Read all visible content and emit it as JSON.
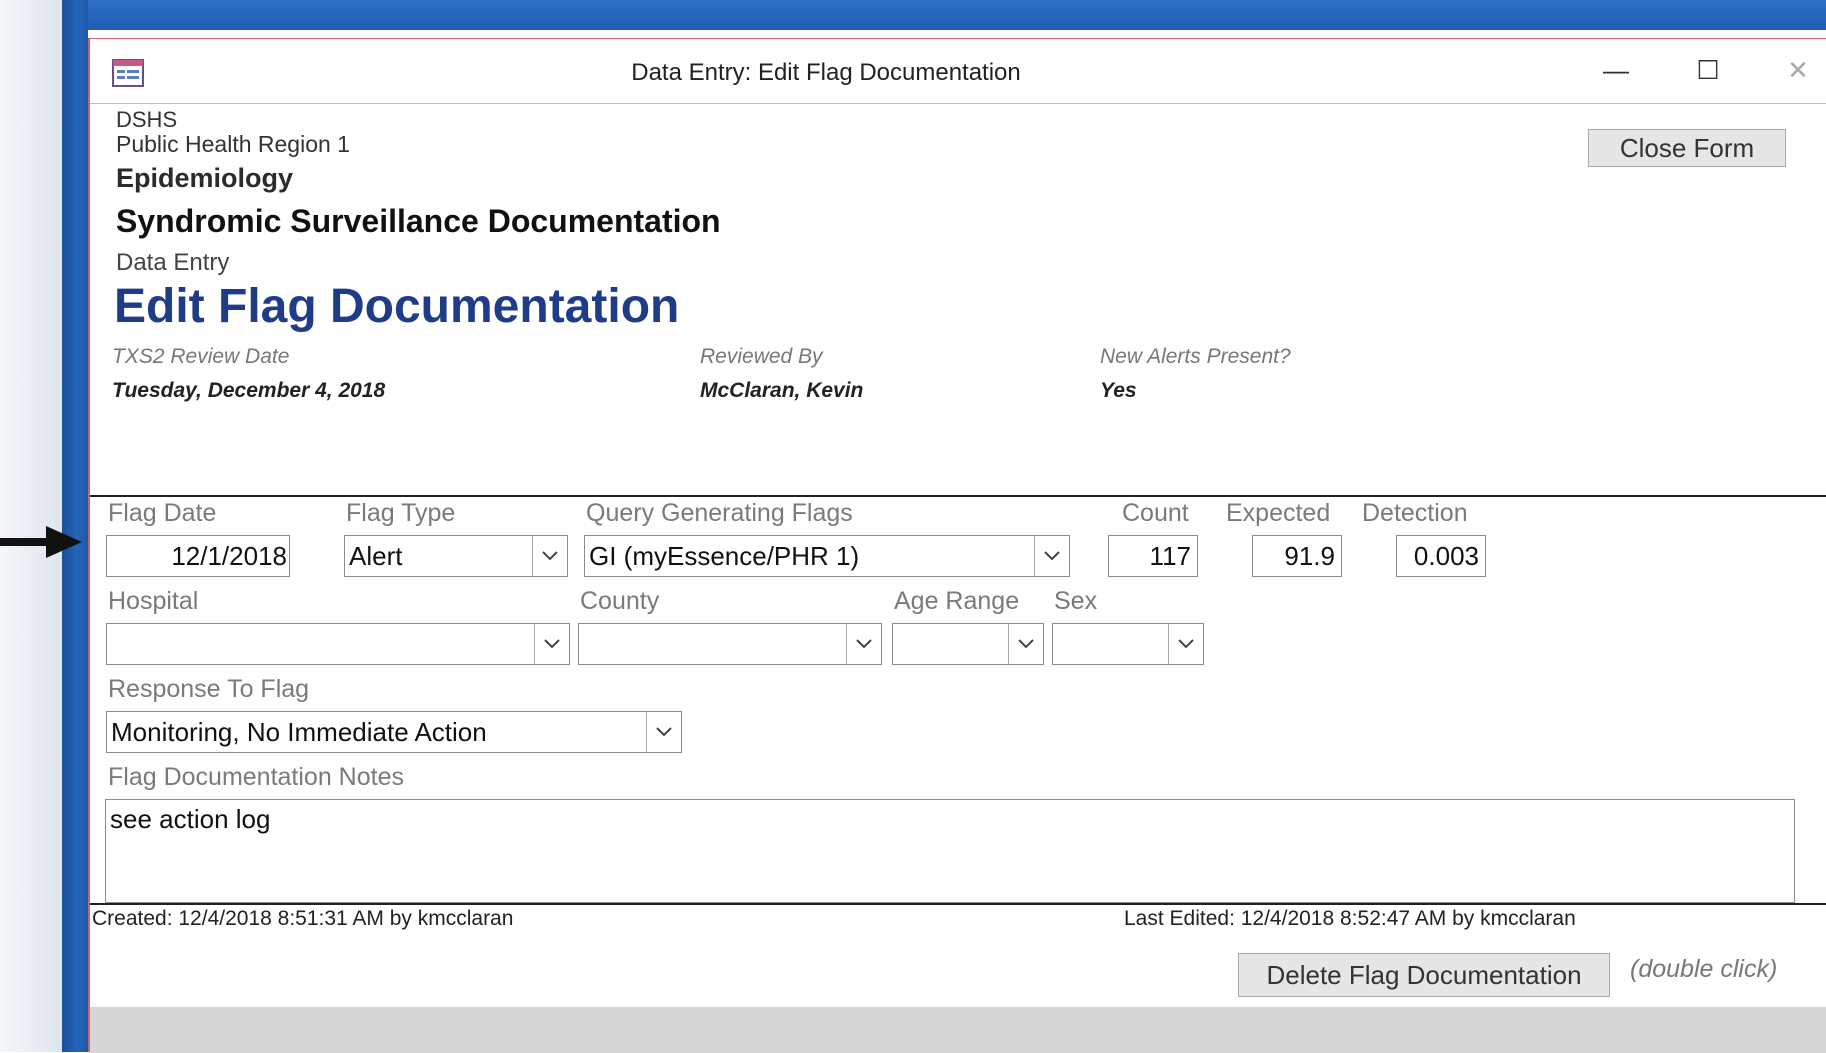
{
  "window": {
    "title": "Data Entry: Edit Flag Documentation"
  },
  "header": {
    "org": "DSHS",
    "region": "Public Health Region 1",
    "dept": "Epidemiology",
    "system": "Syndromic Surveillance Documentation",
    "section": "Data Entry",
    "page_title": "Edit Flag Documentation"
  },
  "close_form_label": "Close Form",
  "review": {
    "date_label": "TXS2 Review Date",
    "date_value": "Tuesday, December 4, 2018",
    "reviewer_label": "Reviewed By",
    "reviewer_value": "McClaran, Kevin",
    "alerts_label": "New Alerts Present?",
    "alerts_value": "Yes"
  },
  "fields": {
    "flag_date": {
      "label": "Flag Date",
      "value": "12/1/2018"
    },
    "flag_type": {
      "label": "Flag Type",
      "value": "Alert"
    },
    "query": {
      "label": "Query Generating Flags",
      "value": "GI (myEssence/PHR 1)"
    },
    "count": {
      "label": "Count",
      "value": "117"
    },
    "expected": {
      "label": "Expected",
      "value": "91.9"
    },
    "detection": {
      "label": "Detection",
      "value": "0.003"
    },
    "hospital": {
      "label": "Hospital",
      "value": ""
    },
    "county": {
      "label": "County",
      "value": ""
    },
    "age_range": {
      "label": "Age Range",
      "value": ""
    },
    "sex": {
      "label": "Sex",
      "value": ""
    },
    "response": {
      "label": "Response To Flag",
      "value": "Monitoring, No Immediate Action"
    },
    "notes": {
      "label": "Flag Documentation Notes",
      "value": "see action log"
    }
  },
  "footer": {
    "created": "Created: 12/4/2018 8:51:31 AM by kmcclaran",
    "last_edited": "Last Edited: 12/4/2018 8:52:47 AM by kmcclaran",
    "delete_label": "Delete Flag Documentation",
    "delete_hint": "(double click)"
  }
}
